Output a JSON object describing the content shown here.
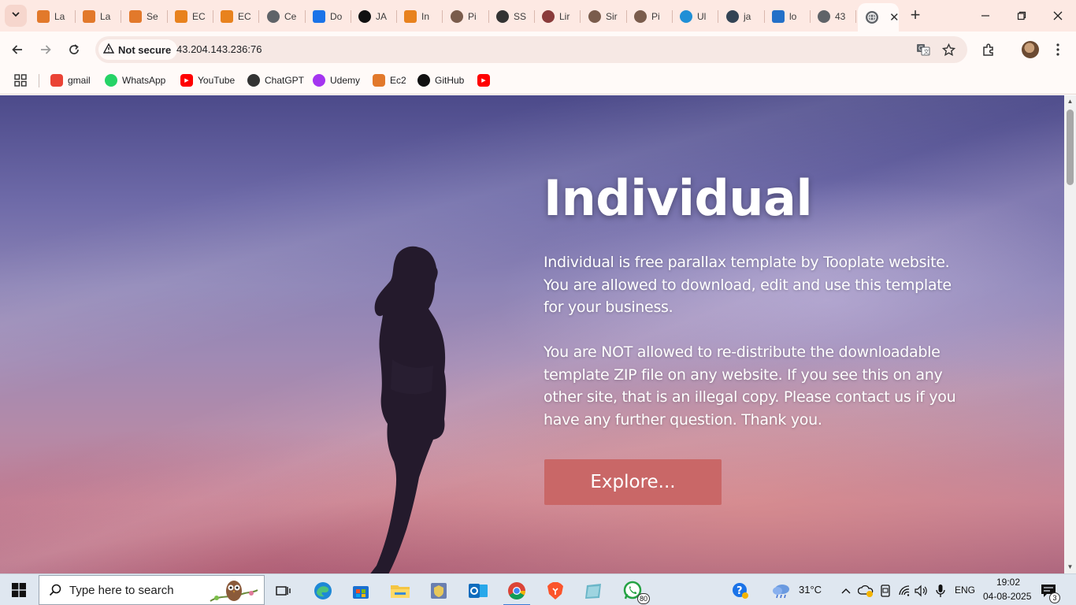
{
  "browser": {
    "tabs": [
      {
        "label": "La",
        "icon": "aws-lab-icon",
        "color": "#e2792b"
      },
      {
        "label": "La",
        "icon": "aws-lab-icon",
        "color": "#e2792b"
      },
      {
        "label": "Se",
        "icon": "aws-lab-icon",
        "color": "#e2792b"
      },
      {
        "label": "EC",
        "icon": "aws-ec2-icon",
        "color": "#e8821e"
      },
      {
        "label": "EC",
        "icon": "aws-ec2-icon",
        "color": "#e8821e"
      },
      {
        "label": "Ce",
        "icon": "globe-icon",
        "color": "#5f6368"
      },
      {
        "label": "Do",
        "icon": "download-icon",
        "color": "#1a73e8"
      },
      {
        "label": "JA",
        "icon": "github-icon",
        "color": "#111111"
      },
      {
        "label": "In",
        "icon": "t-icon",
        "color": "#e8821e"
      },
      {
        "label": "Pi",
        "icon": "avatar-icon",
        "color": "#7a5c4c"
      },
      {
        "label": "SS",
        "icon": "chatgpt-icon",
        "color": "#333333"
      },
      {
        "label": "Lir",
        "icon": "avatar-icon",
        "color": "#8a3b3b"
      },
      {
        "label": "Sir",
        "icon": "avatar-icon",
        "color": "#7a5c4c"
      },
      {
        "label": "Pi",
        "icon": "avatar-icon",
        "color": "#7a5c4c"
      },
      {
        "label": "Ul",
        "icon": "edge-icon",
        "color": "#1f8fd6"
      },
      {
        "label": "ja",
        "icon": "jenkins-icon",
        "color": "#334455"
      },
      {
        "label": "lo",
        "icon": "docker-icon",
        "color": "#2370c8"
      },
      {
        "label": "43",
        "icon": "globe-icon",
        "color": "#5f6368"
      }
    ],
    "active_tab": {
      "label": "",
      "icon": "globe-icon"
    },
    "address": {
      "security_label": "Not secure",
      "url": "43.204.143.236:76"
    },
    "bookmarks": [
      {
        "label": "gmail",
        "icon": "gmail-icon",
        "color": "#ea4335"
      },
      {
        "label": "WhatsApp",
        "icon": "whatsapp-icon",
        "color": "#25d366"
      },
      {
        "label": "YouTube",
        "icon": "youtube-icon",
        "color": "#ff0000"
      },
      {
        "label": "ChatGPT",
        "icon": "chatgpt-icon",
        "color": "#333333"
      },
      {
        "label": "Udemy",
        "icon": "udemy-icon",
        "color": "#a435f0"
      },
      {
        "label": "Ec2",
        "icon": "aws-lab-icon",
        "color": "#e2792b"
      },
      {
        "label": "GitHub",
        "icon": "github-icon",
        "color": "#111111"
      },
      {
        "label": "",
        "icon": "youtube-icon",
        "color": "#ff0000"
      }
    ]
  },
  "page": {
    "title": "Individual",
    "paragraph1": "Individual is free parallax template by Tooplate website. You are allowed to download, edit and use this template for your business.",
    "paragraph2": "You are NOT allowed to re-distribute the downloadable template ZIP file on any website. If you see this on any other site, that is an illegal copy. Please contact us if you have any further question. Thank you.",
    "cta_label": "Explore...",
    "cta_color": "#c96767"
  },
  "taskbar": {
    "search_placeholder": "Type here to search",
    "weather": "31°C",
    "language": "ENG",
    "time": "19:02",
    "date": "04-08-2025",
    "whatsapp_badge": "80",
    "notification_count": "3"
  }
}
